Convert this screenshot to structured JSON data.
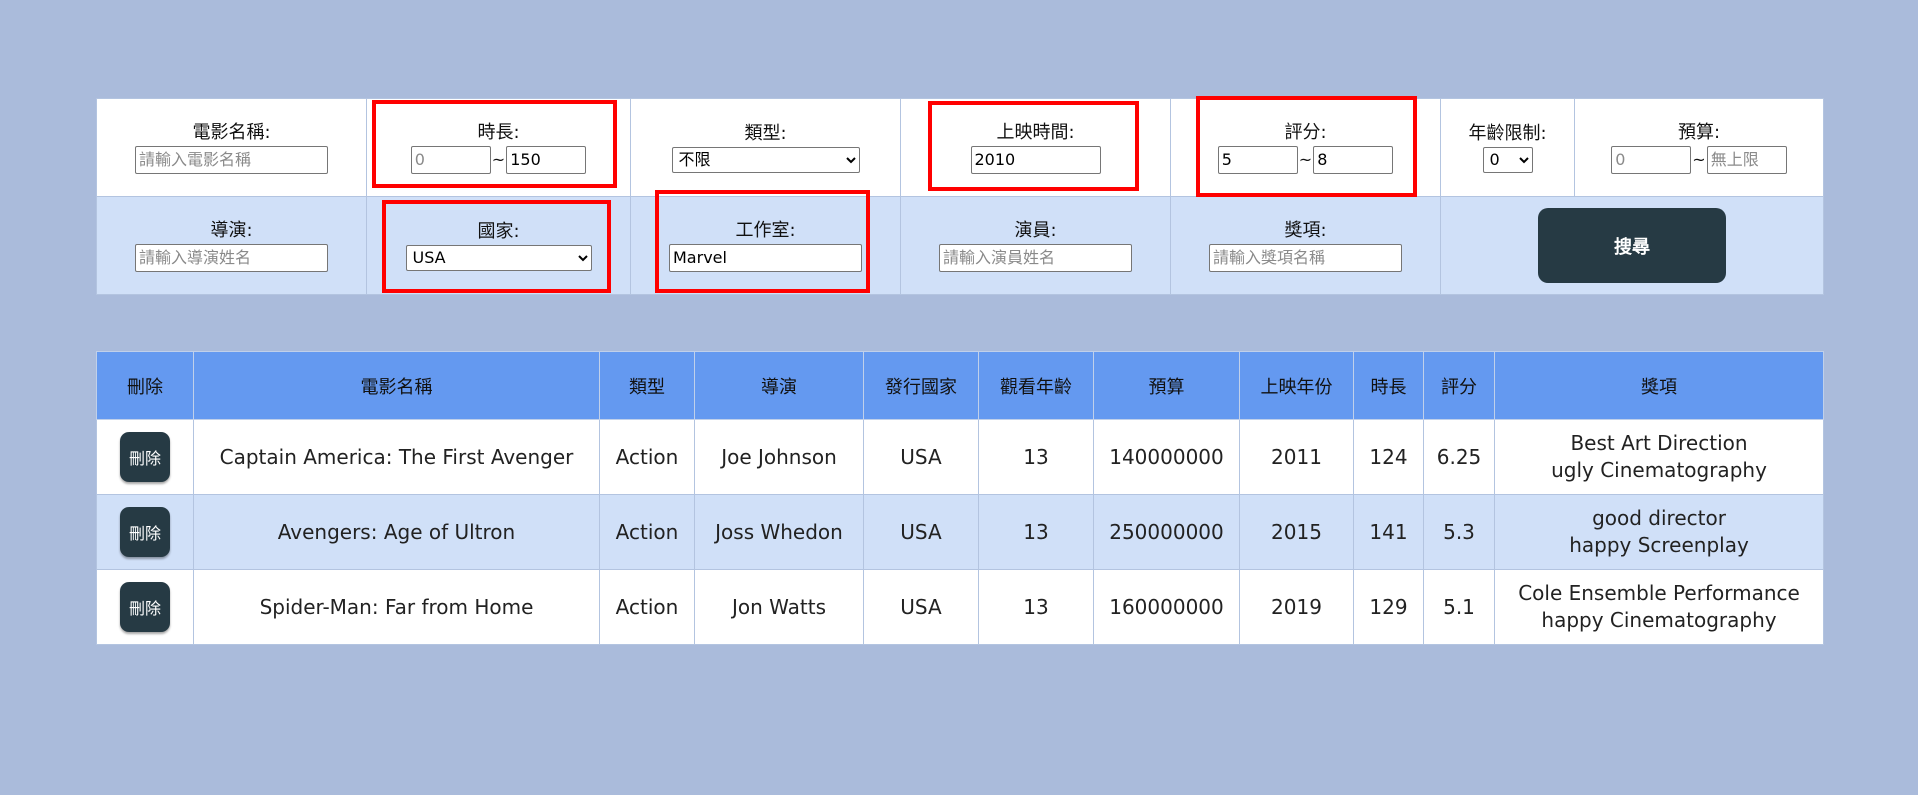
{
  "filters": {
    "name": {
      "label": "電影名稱:",
      "placeholder": "請輸入電影名稱",
      "value": ""
    },
    "duration": {
      "label": "時長:",
      "min_placeholder": "0",
      "min_value": "",
      "separator": "~",
      "max_value": "150"
    },
    "genre": {
      "label": "類型:",
      "selected": "不限"
    },
    "release": {
      "label": "上映時間:",
      "value": "2010"
    },
    "rating": {
      "label": "評分:",
      "min_value": "5",
      "separator": "~",
      "max_value": "8"
    },
    "age": {
      "label": "年齡限制:",
      "selected": "0"
    },
    "budget": {
      "label": "預算:",
      "min_placeholder": "0",
      "separator": "~",
      "max_placeholder": "無上限"
    },
    "director": {
      "label": "導演:",
      "placeholder": "請輸入導演姓名",
      "value": ""
    },
    "country": {
      "label": "國家:",
      "selected": "USA"
    },
    "studio": {
      "label": "工作室:",
      "value": "Marvel"
    },
    "actor": {
      "label": "演員:",
      "placeholder": "請輸入演員姓名",
      "value": ""
    },
    "award": {
      "label": "獎項:",
      "placeholder": "請輸入獎項名稱",
      "value": ""
    },
    "search_label": "搜尋"
  },
  "table": {
    "headers": [
      "刪除",
      "電影名稱",
      "類型",
      "導演",
      "發行國家",
      "觀看年齡",
      "預算",
      "上映年份",
      "時長",
      "評分",
      "獎項"
    ],
    "delete_label": "刪除",
    "rows": [
      {
        "title": "Captain America: The First Avenger",
        "genre": "Action",
        "director": "Joe Johnson",
        "country": "USA",
        "age": "13",
        "budget": "140000000",
        "year": "2011",
        "duration": "124",
        "rating": "6.25",
        "awards": [
          "Best Art Direction",
          "ugly Cinematography"
        ]
      },
      {
        "title": "Avengers: Age of Ultron",
        "genre": "Action",
        "director": "Joss Whedon",
        "country": "USA",
        "age": "13",
        "budget": "250000000",
        "year": "2015",
        "duration": "141",
        "rating": "5.3",
        "awards": [
          "good director",
          "happy Screenplay"
        ]
      },
      {
        "title": "Spider-Man: Far from Home",
        "genre": "Action",
        "director": "Jon Watts",
        "country": "USA",
        "age": "13",
        "budget": "160000000",
        "year": "2019",
        "duration": "129",
        "rating": "5.1",
        "awards": [
          "Cole Ensemble Performance",
          "happy Cinematography"
        ]
      }
    ]
  },
  "colors": {
    "background": "#aabbdb",
    "header": "#6499f0",
    "row_alt": "#d0e0f8",
    "button": "#263a44",
    "highlight": "#ff0000"
  }
}
